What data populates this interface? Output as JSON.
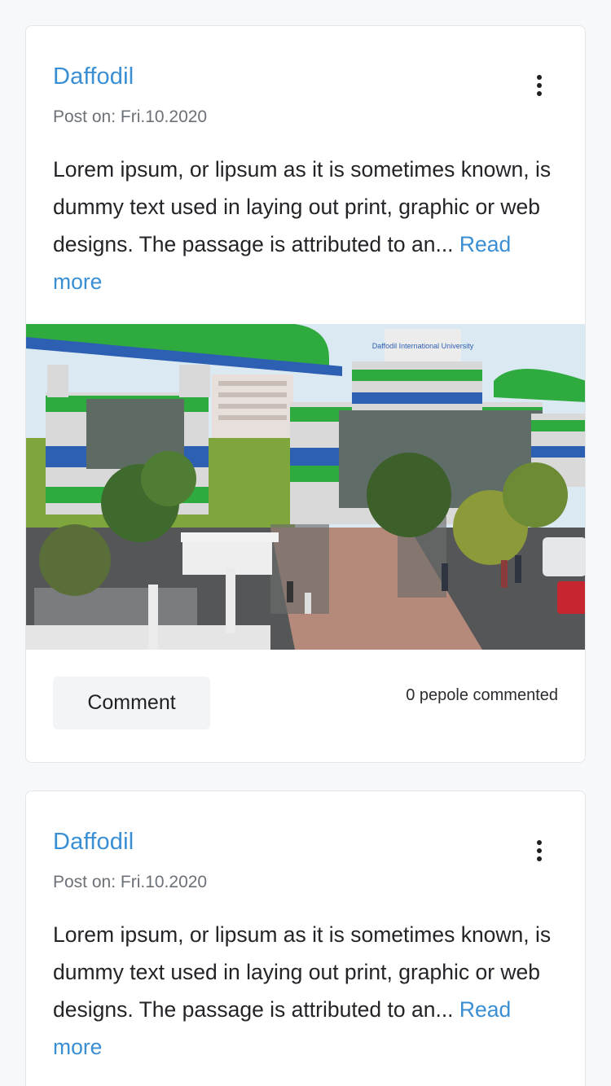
{
  "posts": [
    {
      "author": "Daffodil",
      "date": "Post on: Fri.10.2020",
      "excerpt": "Lorem ipsum, or lipsum as it is sometimes known, is dummy text used in laying out print, graphic or web designs. The passage is attributed to an...",
      "read_more": "Read more",
      "image_sign": "Daffodil International University",
      "comment_label": "Comment",
      "comment_count": "0 pepole commented"
    },
    {
      "author": "Daffodil",
      "date": "Post on: Fri.10.2020",
      "excerpt": "Lorem ipsum, or lipsum as it is sometimes known, is dummy text used in laying out print, graphic or web designs. The passage is attributed to an...",
      "read_more": "Read more"
    }
  ],
  "icons": {
    "menu": "more-vertical-icon"
  },
  "colors": {
    "link": "#3a8fd4",
    "text": "#222427",
    "muted": "#6c7177",
    "background": "#f7f8fa",
    "card": "#ffffff"
  }
}
